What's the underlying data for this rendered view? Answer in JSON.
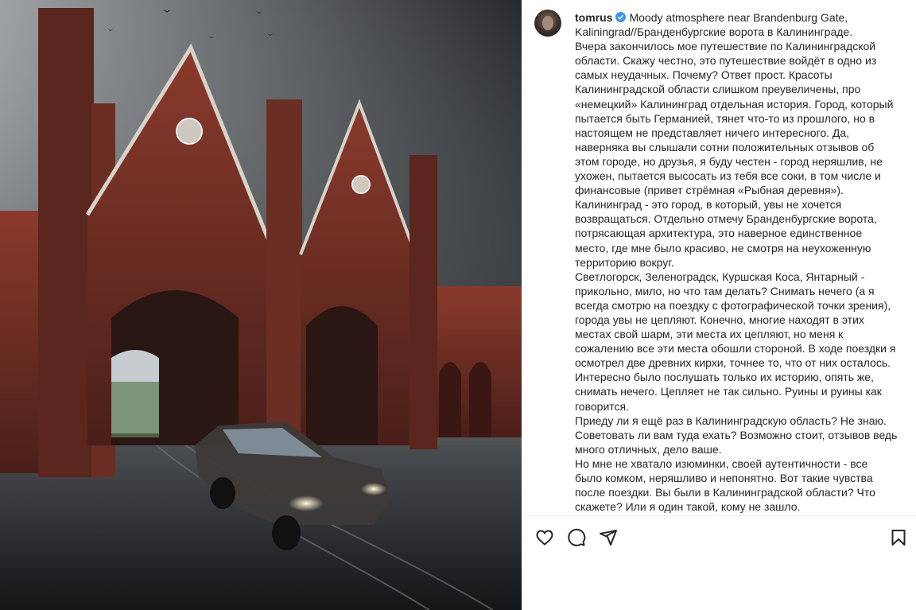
{
  "post": {
    "username": "tomrus",
    "verified_icon": "verified-badge-icon",
    "caption_title": "Moody atmosphere near Brandenburg Gate, Kaliningrad//Бранденбургские ворота в Калининграде.",
    "paragraphs": [
      "Вчера закончилось мое путешествие по Калининградской области. Скажу честно, это путешествие войдёт в одно из самых неудачных. Почему? Ответ прост. Красоты Калининградской области слишком преувеличены, про «немецкий» Калининград отдельная история. Город, который пытается быть Германией, тянет что-то из прошлого, но в настоящем не представляет ничего интересного. Да, наверняка вы слышали сотни положительных отзывов об этом городе, но друзья, я буду честен - город неряшлив, не ухожен, пытается высосать из тебя все соки, в том числе и финансовые (привет стрёмная «Рыбная деревня»). Калининград - это город, в который, увы не хочется возвращаться. Отдельно отмечу Бранденбургские ворота, потрясающая архитектура, это наверное единственное место, где мне было красиво, не смотря на неухоженную территорию вокруг.",
      "Светлогорск, Зеленоградск, Куршская Коса, Янтарный - прикольно, мило, но что там делать? Снимать нечего (а я всегда смотрю на поездку с фотографической точки зрения), города увы не цепляют. Конечно, многие находят в этих местах свой шарм, эти места их цепляют, но меня к сожалению все эти места обошли стороной. В ходе поездки я осмотрел две древних кирхи, точнее то, что от них осталось. Интересно было послушать только их историю, опять же, снимать нечего. Цепляет не так сильно. Руины и руины как говорится.",
      "Приеду ли я ещё раз в Калининградскую область? Не знаю. Советовать ли вам туда ехать? Возможно стоит, отзывов ведь много отличных, дело ваше.",
      "Но мне не хватало изюминки, своей аутентичности - все было комком, неряшливо и непонятно. Вот такие чувства после поездки. Вы были в Калининградской области? Что скажете? Или я один такой, кому не зашло."
    ]
  },
  "actions": {
    "like_icon": "heart-icon",
    "comment_icon": "comment-icon",
    "share_icon": "share-icon",
    "save_icon": "bookmark-icon"
  },
  "colors": {
    "text": "#262626",
    "verified": "#3897f0",
    "divider": "#efefef"
  }
}
